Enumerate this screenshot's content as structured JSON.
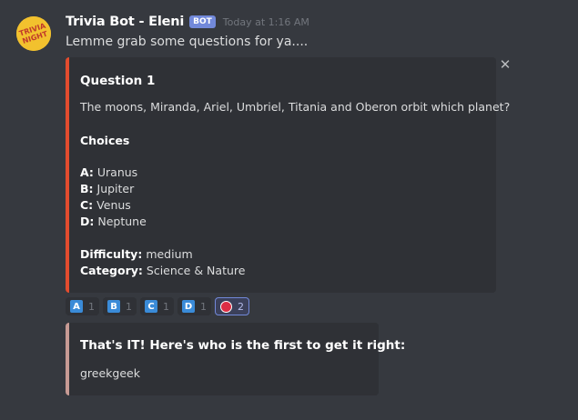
{
  "message": {
    "avatar_text": "TRIVIA NIGHT",
    "username": "Trivia Bot - Eleni",
    "bot_tag": "BOT",
    "timestamp": "Today at 1:16 AM",
    "text": "Lemme grab some questions for ya...."
  },
  "question_embed": {
    "title": "Question 1",
    "question": "The moons, Miranda, Ariel, Umbriel, Titania and Oberon orbit which planet?",
    "choices_heading": "Choices",
    "choices": [
      {
        "key": "A:",
        "value": "Uranus"
      },
      {
        "key": "B:",
        "value": "Jupiter"
      },
      {
        "key": "C:",
        "value": "Venus"
      },
      {
        "key": "D:",
        "value": "Neptune"
      }
    ],
    "difficulty_label": "Difficulty:",
    "difficulty": "medium",
    "category_label": "Category:",
    "category": "Science & Nature",
    "accent_color": "#e34c2e"
  },
  "reactions": [
    {
      "emoji": "A",
      "count": "1"
    },
    {
      "emoji": "B",
      "count": "1"
    },
    {
      "emoji": "C",
      "count": "1"
    },
    {
      "emoji": "D",
      "count": "1"
    },
    {
      "emoji": "red-circle",
      "count": "2"
    }
  ],
  "result_embed": {
    "title": "That's IT! Here's who is the first to get it right:",
    "winner": "greekgeek",
    "accent_color": "#c79a94"
  }
}
